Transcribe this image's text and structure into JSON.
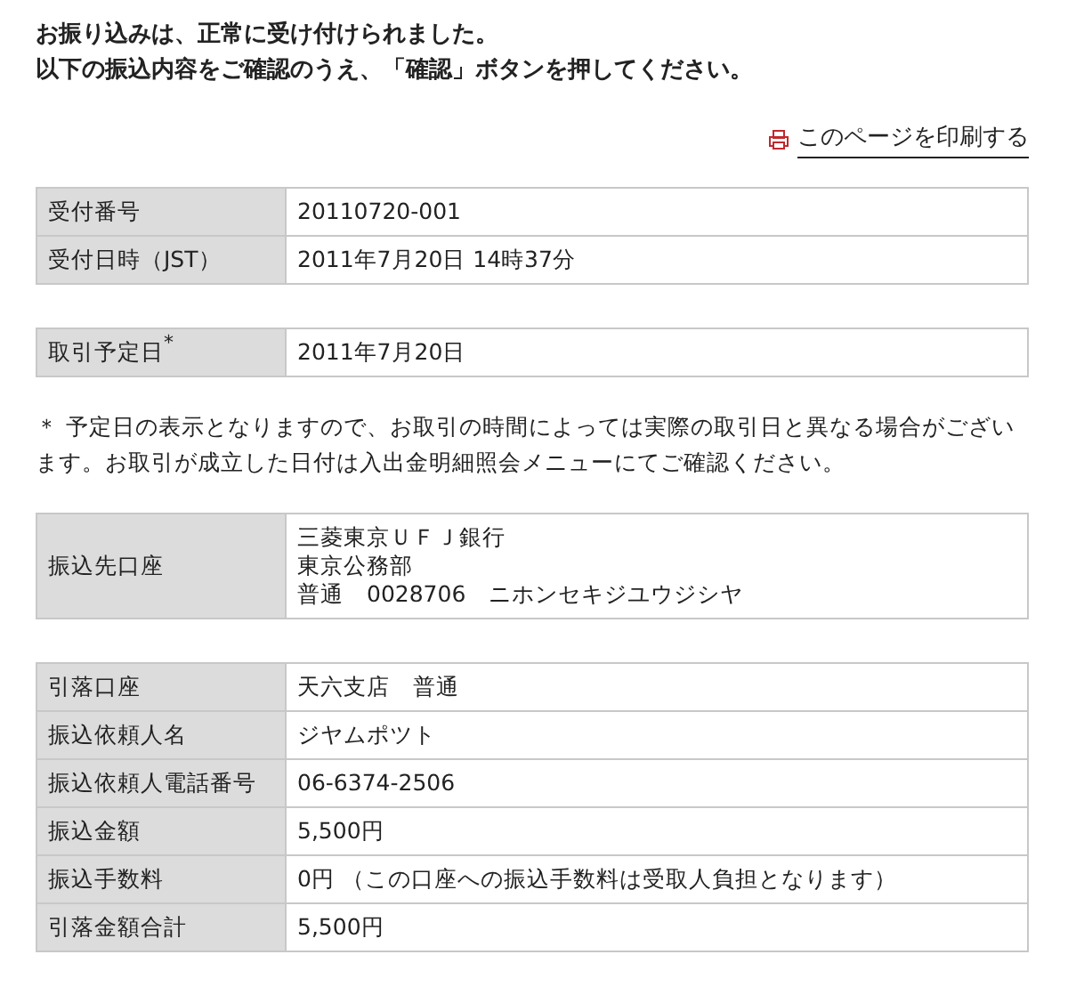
{
  "message": [
    "お振り込みは、正常に受け付けられました。",
    "以下の振込内容をご確認のうえ、「確認」ボタンを押してください。"
  ],
  "print_link": {
    "label": "このページを印刷する"
  },
  "tables": [
    {
      "rows": [
        {
          "label": "受付番号",
          "value": "20110720-001"
        },
        {
          "label": "受付日時（JST）",
          "value": "2011年7月20日 14時37分"
        }
      ]
    },
    {
      "rows": [
        {
          "label": "取引予定日$^{*}$",
          "value": "2011年7月20日"
        }
      ],
      "note": "＊ 予定日の表示となりますので、お取引の時間によっては実際の取引日と異なる場合がございます。お取引が成立した日付は入出金明細照会メニューにてご確認ください。"
    },
    {
      "rows": [
        {
          "label": "振込先口座",
          "lines": [
            "三菱東京ＵＦＪ銀行",
            "東京公務部",
            "普通　0028706　ニホンセキジユウジシヤ"
          ]
        }
      ]
    },
    {
      "rows": [
        {
          "label": "引落口座",
          "value": "天六支店　普通"
        },
        {
          "label": "振込依頼人名",
          "value": "ジヤムポツト"
        },
        {
          "label": "振込依頼人電話番号",
          "value": "06-6374-2506"
        },
        {
          "label": "振込金額",
          "value": "5,500円"
        },
        {
          "label": "振込手数料",
          "value": "0円 （この口座への振込手数料は受取人負担となります）"
        },
        {
          "label": "引落金額合計",
          "value": "5,500円"
        }
      ]
    }
  ]
}
